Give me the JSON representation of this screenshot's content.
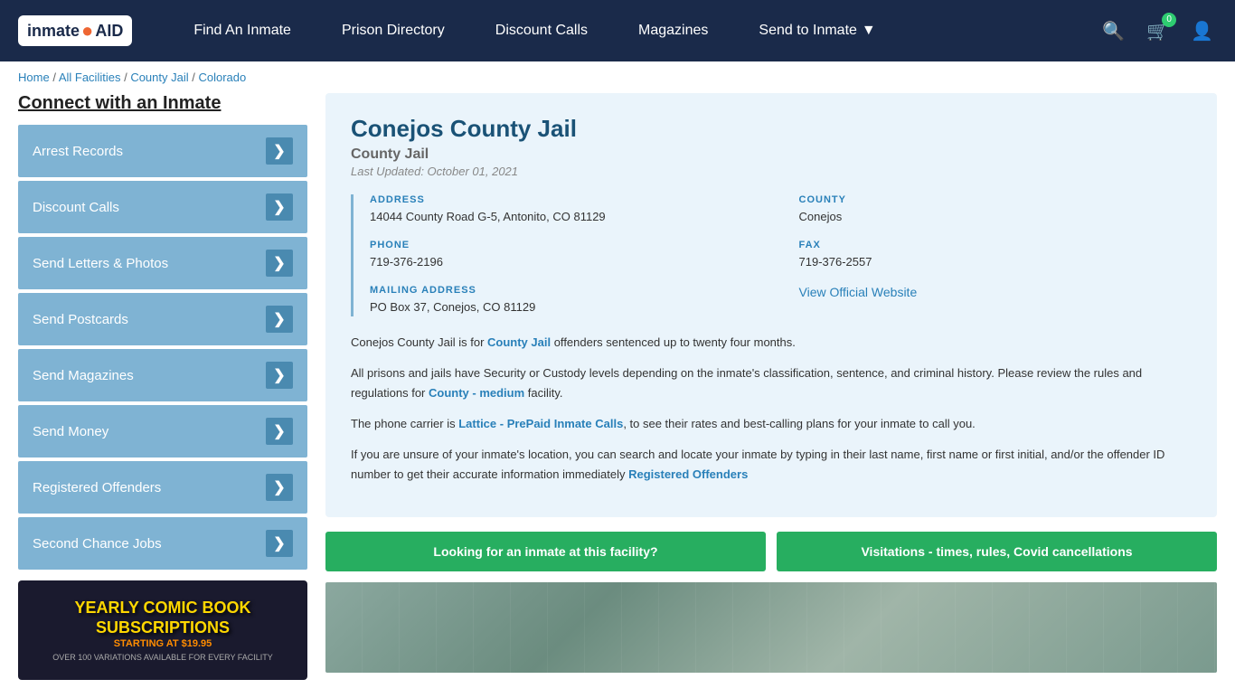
{
  "nav": {
    "logo_inmate": "inmate",
    "logo_aid": "AID",
    "links": [
      {
        "label": "Find An Inmate",
        "id": "find-inmate",
        "dropdown": false
      },
      {
        "label": "Prison Directory",
        "id": "prison-directory",
        "dropdown": false
      },
      {
        "label": "Discount Calls",
        "id": "discount-calls",
        "dropdown": false
      },
      {
        "label": "Magazines",
        "id": "magazines",
        "dropdown": false
      },
      {
        "label": "Send to Inmate",
        "id": "send-to-inmate",
        "dropdown": true
      }
    ],
    "cart_count": "0"
  },
  "breadcrumb": {
    "home": "Home",
    "all_facilities": "All Facilities",
    "county_jail": "County Jail",
    "state": "Colorado"
  },
  "sidebar": {
    "title": "Connect with an Inmate",
    "items": [
      {
        "label": "Arrest Records",
        "id": "arrest-records"
      },
      {
        "label": "Discount Calls",
        "id": "discount-calls"
      },
      {
        "label": "Send Letters & Photos",
        "id": "send-letters"
      },
      {
        "label": "Send Postcards",
        "id": "send-postcards"
      },
      {
        "label": "Send Magazines",
        "id": "send-magazines"
      },
      {
        "label": "Send Money",
        "id": "send-money"
      },
      {
        "label": "Registered Offenders",
        "id": "registered-offenders"
      },
      {
        "label": "Second Chance Jobs",
        "id": "second-chance-jobs"
      }
    ],
    "ad": {
      "title": "YEARLY COMIC BOOK\nSUBSCRIPTIONS",
      "subtitle": "STARTING AT $19.95",
      "desc": "OVER 100 VARIATIONS AVAILABLE FOR EVERY FACILITY"
    }
  },
  "facility": {
    "name": "Conejos County Jail",
    "type": "County Jail",
    "last_updated": "Last Updated: October 01, 2021",
    "address_label": "ADDRESS",
    "address_value": "14044 County Road G-5, Antonito, CO 81129",
    "county_label": "COUNTY",
    "county_value": "Conejos",
    "phone_label": "PHONE",
    "phone_value": "719-376-2196",
    "fax_label": "FAX",
    "fax_value": "719-376-2557",
    "mailing_label": "MAILING ADDRESS",
    "mailing_value": "PO Box 37, Conejos, CO 81129",
    "website_label": "View Official Website",
    "desc1": "Conejos County Jail is for County Jail offenders sentenced up to twenty four months.",
    "desc2": "All prisons and jails have Security or Custody levels depending on the inmate's classification, sentence, and criminal history. Please review the rules and regulations for County - medium facility.",
    "desc3": "The phone carrier is Lattice - PrePaid Inmate Calls, to see their rates and best-calling plans for your inmate to call you.",
    "desc4": "If you are unsure of your inmate's location, you can search and locate your inmate by typing in their last name, first name or first initial, and/or the offender ID number to get their accurate information immediately Registered Offenders",
    "btn_find_inmate": "Looking for an inmate at this facility?",
    "btn_visitations": "Visitations - times, rules, Covid cancellations"
  }
}
